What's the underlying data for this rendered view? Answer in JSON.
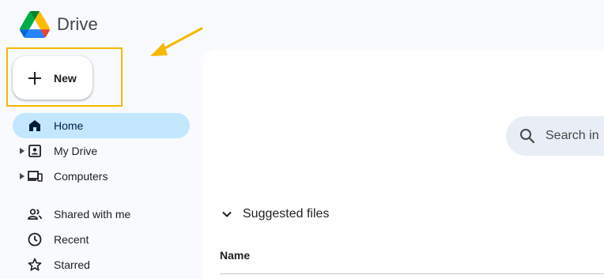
{
  "app": {
    "name": "Drive"
  },
  "new_button": {
    "label": "New"
  },
  "sidebar": {
    "items": [
      {
        "label": "Home",
        "icon": "home-icon",
        "active": true
      },
      {
        "label": "My Drive",
        "icon": "my-drive-icon",
        "expandable": true
      },
      {
        "label": "Computers",
        "icon": "computers-icon",
        "expandable": true
      },
      {
        "label": "Shared with me",
        "icon": "shared-icon"
      },
      {
        "label": "Recent",
        "icon": "clock-icon"
      },
      {
        "label": "Starred",
        "icon": "star-icon"
      }
    ]
  },
  "search": {
    "placeholder": "Search in"
  },
  "main": {
    "section_title": "Suggested files",
    "columns": [
      "Name"
    ]
  },
  "colors": {
    "active_nav_bg": "#c2e7ff",
    "highlight": "#f5b800",
    "page_bg": "#f8fafd",
    "search_bg": "#e9eef6"
  }
}
